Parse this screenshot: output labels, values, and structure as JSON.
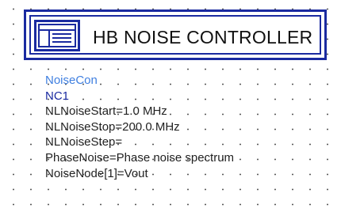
{
  "component": {
    "title": "HB NOISE CONTROLLER",
    "icon": "controller-panel-icon",
    "color": "#1a2aa0"
  },
  "component_name": "NoiseCon",
  "instance_name": "NC1",
  "parameters": [
    "NLNoiseStart=1.0 MHz",
    "NLNoiseStop=200.0 MHz",
    "NLNoiseStep=",
    "PhaseNoise=Phase noise spectrum",
    "NoiseNode[1]=Vout"
  ]
}
